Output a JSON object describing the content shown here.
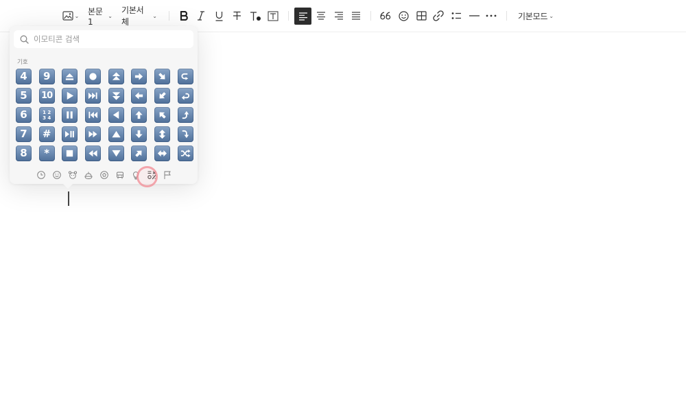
{
  "toolbar": {
    "paragraph_style": "본문1",
    "font_family": "기본서체",
    "mode": "기본모드",
    "caret": "⌄"
  },
  "emoji_picker": {
    "search_placeholder": "이모티콘 검색",
    "section_label": "기호",
    "keys": [
      {
        "t": "4"
      },
      {
        "t": "9"
      },
      {
        "i": "eject"
      },
      {
        "i": "record"
      },
      {
        "i": "fast-up"
      },
      {
        "i": "arrow-right"
      },
      {
        "i": "arrow-down-right"
      },
      {
        "i": "curve-right"
      },
      {
        "t": "5"
      },
      {
        "t": "10"
      },
      {
        "i": "play"
      },
      {
        "i": "next-track"
      },
      {
        "i": "fast-down"
      },
      {
        "i": "arrow-left"
      },
      {
        "i": "arrow-down-left"
      },
      {
        "i": "return-left"
      },
      {
        "t": "6"
      },
      {
        "t": "1234"
      },
      {
        "i": "pause"
      },
      {
        "i": "prev-track"
      },
      {
        "i": "reverse"
      },
      {
        "i": "arrow-up"
      },
      {
        "i": "arrow-up-left"
      },
      {
        "i": "curve-up"
      },
      {
        "t": "7"
      },
      {
        "t": "#"
      },
      {
        "i": "play-pause"
      },
      {
        "i": "fast-forward"
      },
      {
        "i": "up-triangle"
      },
      {
        "i": "arrow-down"
      },
      {
        "i": "arrow-up-down"
      },
      {
        "i": "curve-down"
      },
      {
        "t": "8"
      },
      {
        "t": "*"
      },
      {
        "i": "stop"
      },
      {
        "i": "rewind"
      },
      {
        "i": "down-triangle"
      },
      {
        "i": "arrow-up-right"
      },
      {
        "i": "arrow-left-right"
      },
      {
        "i": "shuffle"
      }
    ],
    "categories": [
      "recent-icon",
      "smiley-icon",
      "animal-icon",
      "food-icon",
      "sports-icon",
      "travel-icon",
      "lightbulb-icon",
      "symbols-icon",
      "flag-icon"
    ],
    "selected_category": "symbols-icon"
  },
  "colors": {
    "key_gradient_top": "#8aa5c7",
    "key_gradient_bottom": "#4f6f98",
    "active_button": "#2d2d2d",
    "highlight_ring": "#f08c96"
  }
}
